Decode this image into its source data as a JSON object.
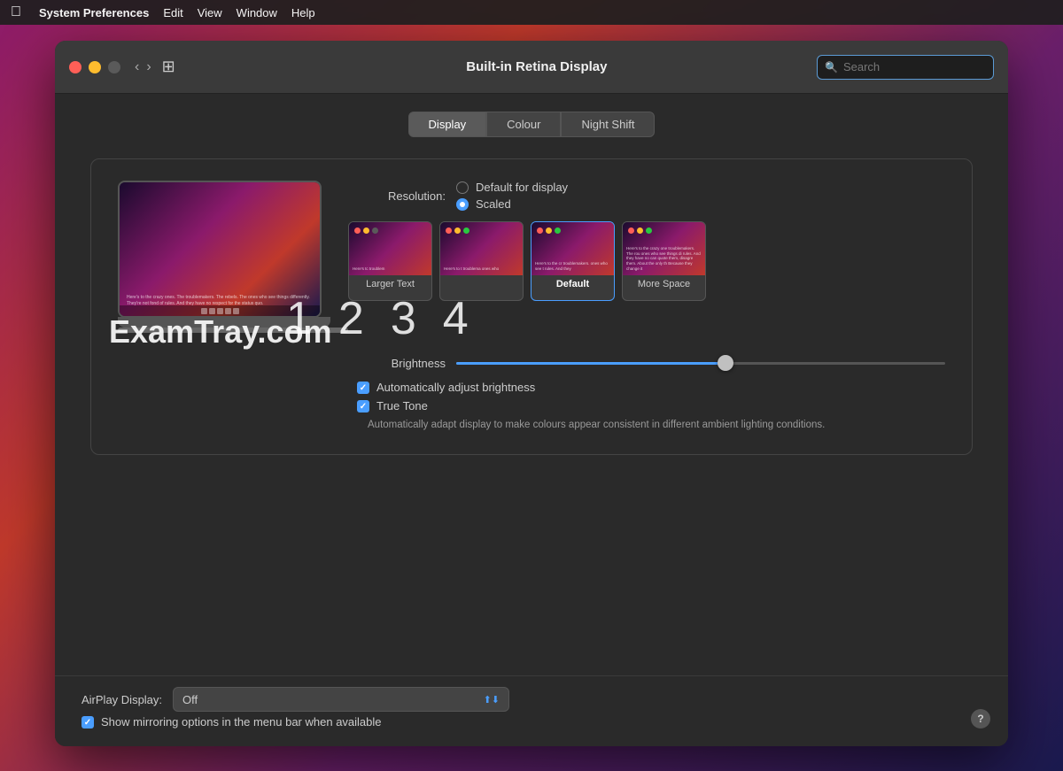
{
  "menubar": {
    "apple": "⌘",
    "items": [
      "System Preferences",
      "Edit",
      "View",
      "Window",
      "Help"
    ]
  },
  "titlebar": {
    "title": "Built-in Retina Display",
    "search_placeholder": "Search"
  },
  "tabs": [
    {
      "label": "Display",
      "active": true
    },
    {
      "label": "Colour",
      "active": false
    },
    {
      "label": "Night Shift",
      "active": false
    }
  ],
  "resolution": {
    "label": "Resolution:",
    "options": [
      {
        "label": "Default for display",
        "selected": false
      },
      {
        "label": "Scaled",
        "selected": true
      }
    ]
  },
  "scale_options": [
    {
      "label": "Larger Text",
      "bold": false,
      "num": "1"
    },
    {
      "label": "",
      "bold": false,
      "num": "2"
    },
    {
      "label": "Default",
      "bold": true,
      "num": "3"
    },
    {
      "label": "More Space",
      "bold": false,
      "num": "4"
    }
  ],
  "brightness": {
    "label": "Brightness",
    "value": 55
  },
  "checkboxes": [
    {
      "label": "Automatically adjust brightness",
      "checked": true
    },
    {
      "label": "True Tone",
      "checked": true
    }
  ],
  "true_tone_desc": "Automatically adapt display to make colours appear consistent in different ambient lighting conditions.",
  "airplay": {
    "label": "AirPlay Display:",
    "value": "Off"
  },
  "mirror_checkbox": {
    "label": "Show mirroring options in the menu bar when available",
    "checked": true
  },
  "watermark": "ExamTray.com",
  "numbers": [
    "1",
    "2",
    "3",
    "4"
  ]
}
